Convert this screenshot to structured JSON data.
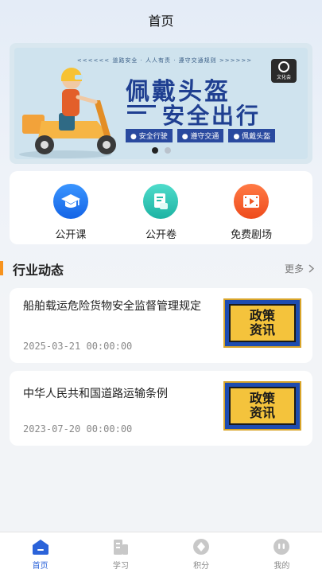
{
  "header": {
    "title": "首页"
  },
  "banner": {
    "top_strip": "<<<<<<  道路安全 · 人人有责 · 遵守交通规则  >>>>>>",
    "logo_text": "文化会",
    "headline_1": "佩戴头盔",
    "headline_2": "安全出行",
    "tags": [
      "● 安全行驶",
      "● 遵守交通",
      "● 佩戴头盔"
    ],
    "pages": 2,
    "active_page": 1
  },
  "quick_menu": [
    {
      "label": "公开课",
      "icon": "graduation-cap-icon",
      "color": "#1f7bf0"
    },
    {
      "label": "公开卷",
      "icon": "document-icon",
      "color": "#2cc7b6"
    },
    {
      "label": "免费剧场",
      "icon": "film-icon",
      "color": "#f5582a"
    }
  ],
  "section": {
    "title": "行业动态",
    "more": "更多"
  },
  "news": [
    {
      "title": "船舶载运危险货物安全监督管理规定",
      "date": "2025-03-21 00:00:00",
      "thumb_line1": "政策",
      "thumb_line2": "资讯"
    },
    {
      "title": "中华人民共和国道路运输条例",
      "date": "2023-07-20 00:00:00",
      "thumb_line1": "政策",
      "thumb_line2": "资讯"
    }
  ],
  "tabbar": {
    "items": [
      {
        "label": "首页",
        "icon": "home-icon",
        "active": true
      },
      {
        "label": "学习",
        "icon": "building-icon",
        "active": false
      },
      {
        "label": "积分",
        "icon": "points-icon",
        "active": false
      },
      {
        "label": "我的",
        "icon": "profile-icon",
        "active": false
      }
    ]
  },
  "colors": {
    "accent": "#2b63d9",
    "section_bar": "#f7931e",
    "banner_text": "#1f3f91"
  }
}
